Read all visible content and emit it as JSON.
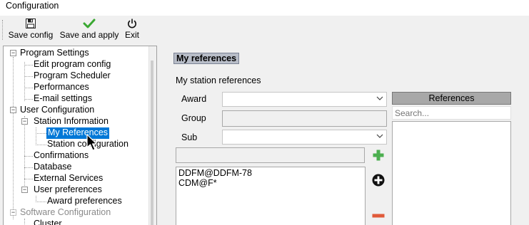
{
  "window": {
    "title": "Configuration"
  },
  "toolbar": {
    "save_config": {
      "label": "Save config",
      "icon": "floppy-icon"
    },
    "save_apply": {
      "label": "Save and apply",
      "icon": "checkmark-icon"
    },
    "exit": {
      "label": "Exit",
      "icon": "power-icon"
    }
  },
  "tree": {
    "program_settings": "Program Settings",
    "edit_program_config": "Edit program config",
    "program_scheduler": "Program Scheduler",
    "performances": "Performances",
    "email_settings": "E-mail settings",
    "user_configuration": "User Configuration",
    "station_information": "Station Information",
    "my_references": "My References",
    "station_configuration": "Station configuration",
    "confirmations": "Confirmations",
    "database": "Database",
    "external_services": "External Services",
    "user_preferences": "User preferences",
    "award_preferences": "Award preferences",
    "software_configuration": "Software Configuration",
    "cluster": "Cluster"
  },
  "main": {
    "header": "My references",
    "section_title": "My station references",
    "award_label": "Award",
    "award_value": "",
    "group_label": "Group",
    "group_value": "",
    "sub_label": "Sub",
    "sub_value": "",
    "entry_value": "",
    "list_items": [
      "DDFM@DDFM-78",
      "CDM@F*"
    ]
  },
  "references_panel": {
    "header": "References",
    "search_placeholder": "Search..."
  },
  "colors": {
    "selection": "#0078d7",
    "add_green": "#4caf50",
    "remove_red": "#e05a3a",
    "header_bg": "#b8bdc8"
  }
}
